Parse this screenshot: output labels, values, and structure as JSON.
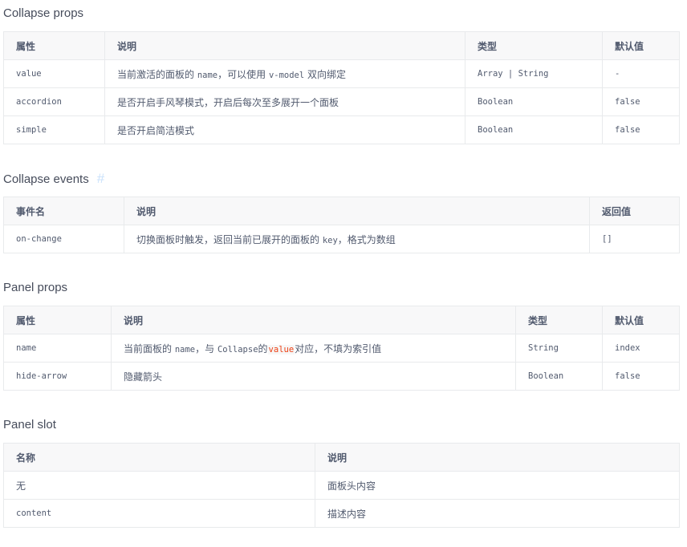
{
  "collapse_props": {
    "title": "Collapse props",
    "headers": [
      "属性",
      "说明",
      "类型",
      "默认值"
    ],
    "rows": [
      {
        "name": "value",
        "desc_a": "当前激活的面板的 ",
        "desc_code": "name",
        "desc_b": "，可以使用 ",
        "desc_code2": "v-model",
        "desc_c": " 双向绑定",
        "type": "Array | String",
        "default": "-"
      },
      {
        "name": "accordion",
        "desc": "是否开启手风琴模式，开启后每次至多展开一个面板",
        "type": "Boolean",
        "default": "false"
      },
      {
        "name": "simple",
        "desc": "是否开启简洁模式",
        "type": "Boolean",
        "default": "false"
      }
    ]
  },
  "collapse_events": {
    "title": "Collapse events",
    "anchor": "#",
    "headers": [
      "事件名",
      "说明",
      "返回值"
    ],
    "rows": [
      {
        "name": "on-change",
        "desc_a": "切换面板时触发，返回当前已展开的面板的 ",
        "desc_code": "key",
        "desc_b": "，格式为数组",
        "ret": "[]"
      }
    ]
  },
  "panel_props": {
    "title": "Panel props",
    "headers": [
      "属性",
      "说明",
      "类型",
      "默认值"
    ],
    "rows": [
      {
        "name": "name",
        "desc_a": "当前面板的 ",
        "desc_code": "name",
        "desc_b": "，与 ",
        "desc_code2": "Collapse",
        "desc_c": "的",
        "desc_hl": "value",
        "desc_d": "对应，不填为索引值",
        "type": "String",
        "default": "index"
      },
      {
        "name": "hide-arrow",
        "desc": "隐藏箭头",
        "type": "Boolean",
        "default": "false"
      }
    ]
  },
  "panel_slot": {
    "title": "Panel slot",
    "headers": [
      "名称",
      "说明"
    ],
    "rows": [
      {
        "name": "无",
        "desc": "面板头内容"
      },
      {
        "name": "content",
        "desc": "描述内容"
      }
    ]
  }
}
